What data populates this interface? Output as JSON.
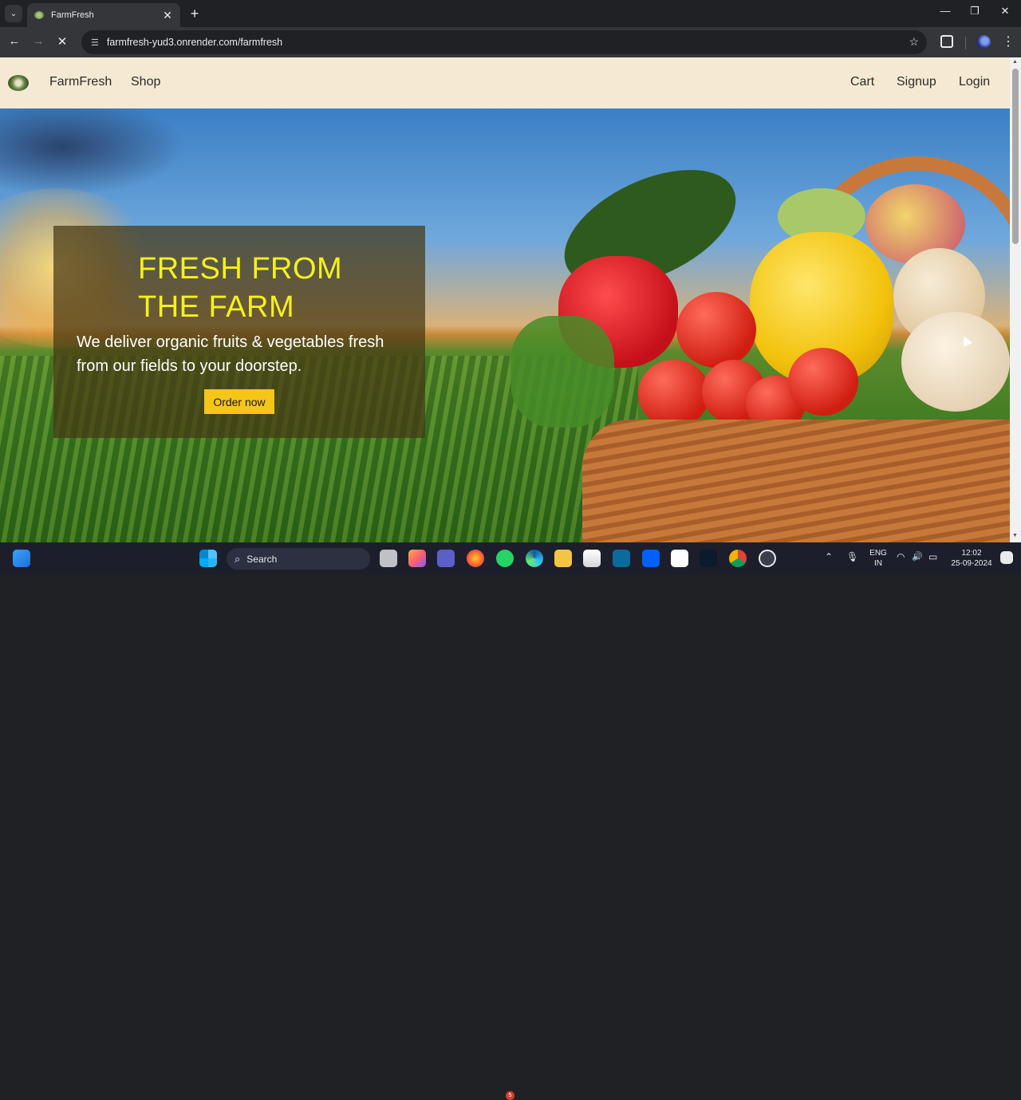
{
  "browser": {
    "tab_title": "FarmFresh",
    "url": "farmfresh-yud3.onrender.com/farmfresh",
    "icons": {
      "tab_search": "chevron-down-icon",
      "new_tab": "plus-icon",
      "back": "arrow-left-icon",
      "forward": "arrow-right-icon",
      "stop": "close-icon",
      "site_info": "tune-icon",
      "bookmark": "star-icon",
      "extensions": "puzzle-icon",
      "menu": "kebab-icon"
    },
    "glyphs": {
      "tab_search": "⌄",
      "tab_close": "✕",
      "new_tab": "+",
      "minimize": "—",
      "maximize": "❐",
      "close": "✕",
      "back": "←",
      "forward": "→",
      "stop": "✕",
      "tune": "☰",
      "star": "☆",
      "menu": "⋮"
    }
  },
  "site": {
    "nav": {
      "brand": "FarmFresh",
      "shop": "Shop",
      "cart": "Cart",
      "signup": "Signup",
      "login": "Login"
    },
    "hero": {
      "headline_line1": "FRESH FROM",
      "headline_line2": "THE FARM",
      "subtitle": "We deliver organic fruits & vegetables fresh from our fields to your doorstep.",
      "cta": "Order now"
    },
    "colors": {
      "nav_bg": "#f6e9d3",
      "headline": "#f4f11d",
      "cta_bg": "#f5c518",
      "overlay": "rgba(70,55,20,0.72)"
    }
  },
  "taskbar": {
    "search_label": "Search",
    "search_glyph": "⌕",
    "language_line1": "ENG",
    "language_line2": "IN",
    "time": "12:02",
    "date": "25-09-2024",
    "whatsapp_badge": "5",
    "tray_glyphs": {
      "chevron_up": "⌃",
      "mic": "🎙",
      "wifi": "◠",
      "volume": "🔊",
      "battery": "▭"
    }
  }
}
